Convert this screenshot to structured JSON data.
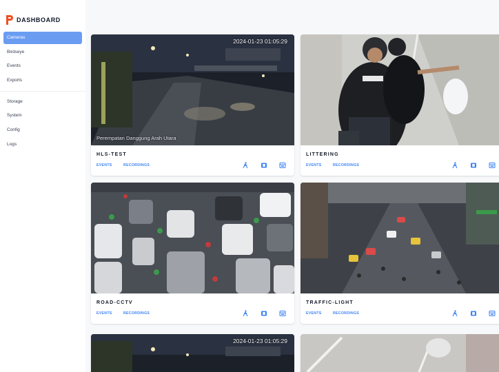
{
  "brand": {
    "title": "DASHBOARD",
    "accent": "#f04e23"
  },
  "sidebar": {
    "items": [
      {
        "label": "Cameras",
        "active": true
      },
      {
        "label": "Birdseye",
        "active": false
      },
      {
        "label": "Events",
        "active": false
      },
      {
        "label": "Exports",
        "active": false
      },
      {
        "label": "Storage",
        "active": false
      },
      {
        "label": "System",
        "active": false
      },
      {
        "label": "Config",
        "active": false
      },
      {
        "label": "Logs",
        "active": false
      }
    ]
  },
  "cameras": [
    {
      "name": "HLS-TEST",
      "timestamp": "2024-01-23 01:05:29",
      "overlay": "Perempatan Danggung Arah Utara",
      "events_label": "EVENTS",
      "recordings_label": "RECORDINGS"
    },
    {
      "name": "LITTERING",
      "events_label": "EVENTS",
      "recordings_label": "RECORDINGS"
    },
    {
      "name": "ROAD-CCTV",
      "events_label": "EVENTS",
      "recordings_label": "RECORDINGS"
    },
    {
      "name": "TRAFFIC-LIGHT",
      "events_label": "EVENTS",
      "recordings_label": "RECORDINGS"
    },
    {
      "timestamp": "2024-01-23 01:05:29"
    },
    {}
  ],
  "colors": {
    "active_nav": "#6a9df2",
    "link": "#3b82f6",
    "icon": "#3b82f6"
  }
}
